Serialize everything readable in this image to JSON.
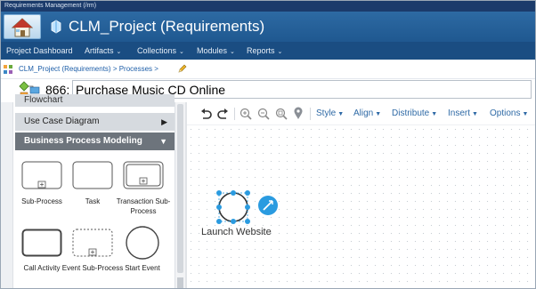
{
  "app": {
    "title": "Requirements Management (/rm)",
    "project_title": "CLM_Project (Requirements)"
  },
  "menu": [
    {
      "label": "Project Dashboard",
      "has_caret": false
    },
    {
      "label": "Artifacts",
      "has_caret": true
    },
    {
      "label": "Collections",
      "has_caret": true
    },
    {
      "label": "Modules",
      "has_caret": true
    },
    {
      "label": "Reports",
      "has_caret": true
    }
  ],
  "breadcrumb": "CLM_Project (Requirements) > Processes >",
  "artifact": {
    "id": "866:",
    "name": "Purchase Music CD Online"
  },
  "palette": {
    "sections": {
      "cut_off": "Flowchart",
      "use_case": "Use Case Diagram",
      "bpm": "Business Process Modeling"
    },
    "shapes": [
      {
        "label": "Sub-Process"
      },
      {
        "label": "Task"
      },
      {
        "label": "Transaction Sub-Process"
      },
      {
        "label": "Call Activity"
      },
      {
        "label": "Event Sub-Process"
      },
      {
        "label": "Start Event"
      }
    ]
  },
  "toolbar": {
    "menus": [
      "Style",
      "Align",
      "Distribute",
      "Insert",
      "Options"
    ]
  },
  "canvas": {
    "node_label": "Launch Website"
  },
  "colors": {
    "banner": "#2d6aa3",
    "menubar": "#1a4d82",
    "link": "#1d5ea8",
    "selection_handle": "#2a9be0",
    "bpm_header": "#6d747c"
  }
}
